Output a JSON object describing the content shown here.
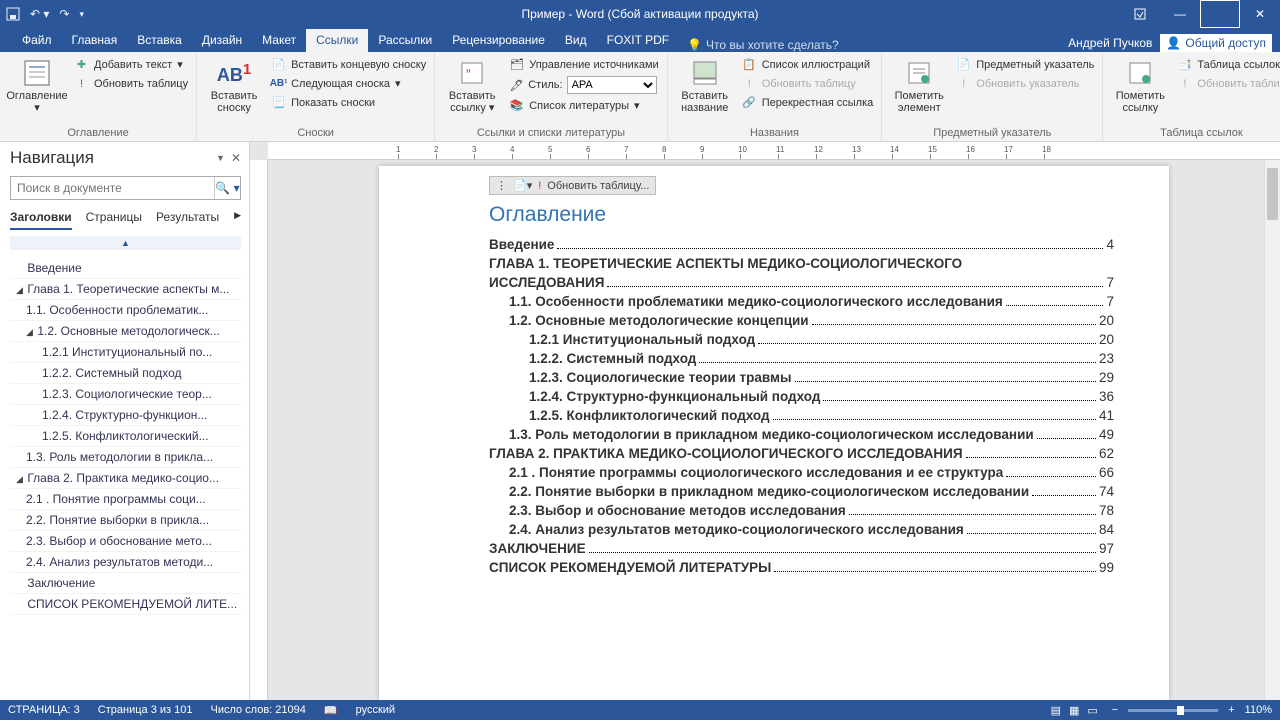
{
  "titlebar": {
    "title": "Пример - Word (Сбой активации продукта)"
  },
  "tabs": {
    "items": [
      "Файл",
      "Главная",
      "Вставка",
      "Дизайн",
      "Макет",
      "Ссылки",
      "Рассылки",
      "Рецензирование",
      "Вид",
      "FOXIT PDF"
    ],
    "active_index": 5,
    "tell_me": "Что вы хотите сделать?",
    "user": "Андрей Пучков",
    "share": "Общий доступ"
  },
  "ribbon": {
    "g1": {
      "big": "Оглавление",
      "a": "Добавить текст",
      "b": "Обновить таблицу",
      "label": "Оглавление"
    },
    "g2": {
      "big1": "Вставить сноску",
      "a": "Вставить концевую сноску",
      "b": "Следующая сноска",
      "c": "Показать сноски",
      "label": "Сноски"
    },
    "g3": {
      "big": "Вставить ссылку",
      "a": "Управление источниками",
      "b_label": "Стиль:",
      "b_value": "APA",
      "c": "Список литературы",
      "label": "Ссылки и списки литературы"
    },
    "g4": {
      "big": "Вставить название",
      "a": "Список иллюстраций",
      "b": "Обновить таблицу",
      "c": "Перекрестная ссылка",
      "label": "Названия"
    },
    "g5": {
      "big": "Пометить элемент",
      "a": "Предметный указатель",
      "b": "Обновить указатель",
      "label": "Предметный указатель"
    },
    "g6": {
      "big": "Пометить ссылку",
      "a": "Таблица ссылок",
      "b": "Обновить таблицу",
      "label": "Таблица ссылок"
    }
  },
  "nav": {
    "title": "Навигация",
    "search_placeholder": "Поиск в документе",
    "tabs": [
      "Заголовки",
      "Страницы",
      "Результаты"
    ],
    "tree": [
      {
        "t": "Введение",
        "l": 0
      },
      {
        "t": "Глава 1. Теоретические аспекты м...",
        "l": 0,
        "c": true
      },
      {
        "t": "1.1. Особенности проблематик...",
        "l": 1
      },
      {
        "t": "1.2. Основные методологическ...",
        "l": 1,
        "c": true
      },
      {
        "t": "1.2.1 Институциональный по...",
        "l": 2
      },
      {
        "t": "1.2.2. Системный подход",
        "l": 2
      },
      {
        "t": "1.2.3. Социологические теор...",
        "l": 2
      },
      {
        "t": "1.2.4. Структурно-функцион...",
        "l": 2
      },
      {
        "t": "1.2.5. Конфликтологический...",
        "l": 2
      },
      {
        "t": "1.3. Роль методологии в прикла...",
        "l": 1
      },
      {
        "t": "Глава 2. Практика медико-социо...",
        "l": 0,
        "c": true
      },
      {
        "t": "2.1 . Понятие программы соци...",
        "l": 1
      },
      {
        "t": "2.2. Понятие выборки в прикла...",
        "l": 1
      },
      {
        "t": "2.3. Выбор и обоснование мето...",
        "l": 1
      },
      {
        "t": "2.4. Анализ результатов методи...",
        "l": 1
      },
      {
        "t": "Заключение",
        "l": 0
      },
      {
        "t": "СПИСОК РЕКОМЕНДУЕМОЙ ЛИТЕ...",
        "l": 0
      }
    ]
  },
  "doc": {
    "update": "Обновить таблицу...",
    "heading": "Оглавление",
    "toc": [
      {
        "t": "Введение",
        "p": "4",
        "l": 0
      },
      {
        "t": "ГЛАВА 1. ТЕОРЕТИЧЕСКИЕ АСПЕКТЫ МЕДИКО-СОЦИОЛОГИЧЕСКОГО ИССЛЕДОВАНИЯ",
        "p": "7",
        "l": 0,
        "wrap": true
      },
      {
        "t": "1.1. Особенности проблематики медико-социологического исследования",
        "p": "7",
        "l": 1
      },
      {
        "t": "1.2. Основные методологические концепции",
        "p": "20",
        "l": 1
      },
      {
        "t": "1.2.1 Институциональный подход",
        "p": "20",
        "l": 2
      },
      {
        "t": "1.2.2. Системный подход",
        "p": "23",
        "l": 2
      },
      {
        "t": "1.2.3. Социологические теории травмы",
        "p": "29",
        "l": 2
      },
      {
        "t": "1.2.4. Структурно-функциональный подход",
        "p": "36",
        "l": 2
      },
      {
        "t": "1.2.5. Конфликтологический подход",
        "p": "41",
        "l": 2
      },
      {
        "t": "1.3. Роль методологии в прикладном медико-социологическом исследовании",
        "p": "49",
        "l": 1
      },
      {
        "t": "ГЛАВА 2. ПРАКТИКА МЕДИКО-СОЦИОЛОГИЧЕСКОГО ИССЛЕДОВАНИЯ",
        "p": "62",
        "l": 0
      },
      {
        "t": "2.1    . Понятие программы социологического исследования и ее структура",
        "p": "66",
        "l": 1
      },
      {
        "t": "2.2. Понятие выборки в прикладном медико-социологическом исследовании",
        "p": "74",
        "l": 1
      },
      {
        "t": "2.3. Выбор и обоснование методов исследования",
        "p": "78",
        "l": 1
      },
      {
        "t": "2.4. Анализ результатов методико-социологического исследования",
        "p": "84",
        "l": 1
      },
      {
        "t": "ЗАКЛЮЧЕНИЕ",
        "p": "97",
        "l": 0
      },
      {
        "t": "СПИСОК РЕКОМЕНДУЕМОЙ ЛИТЕРАТУРЫ",
        "p": "99",
        "l": 0
      }
    ]
  },
  "status": {
    "page_label": "СТРАНИЦА: 3",
    "page_of": "Страница 3 из 101",
    "words": "Число слов: 21094",
    "lang": "русский",
    "zoom": "110%"
  }
}
